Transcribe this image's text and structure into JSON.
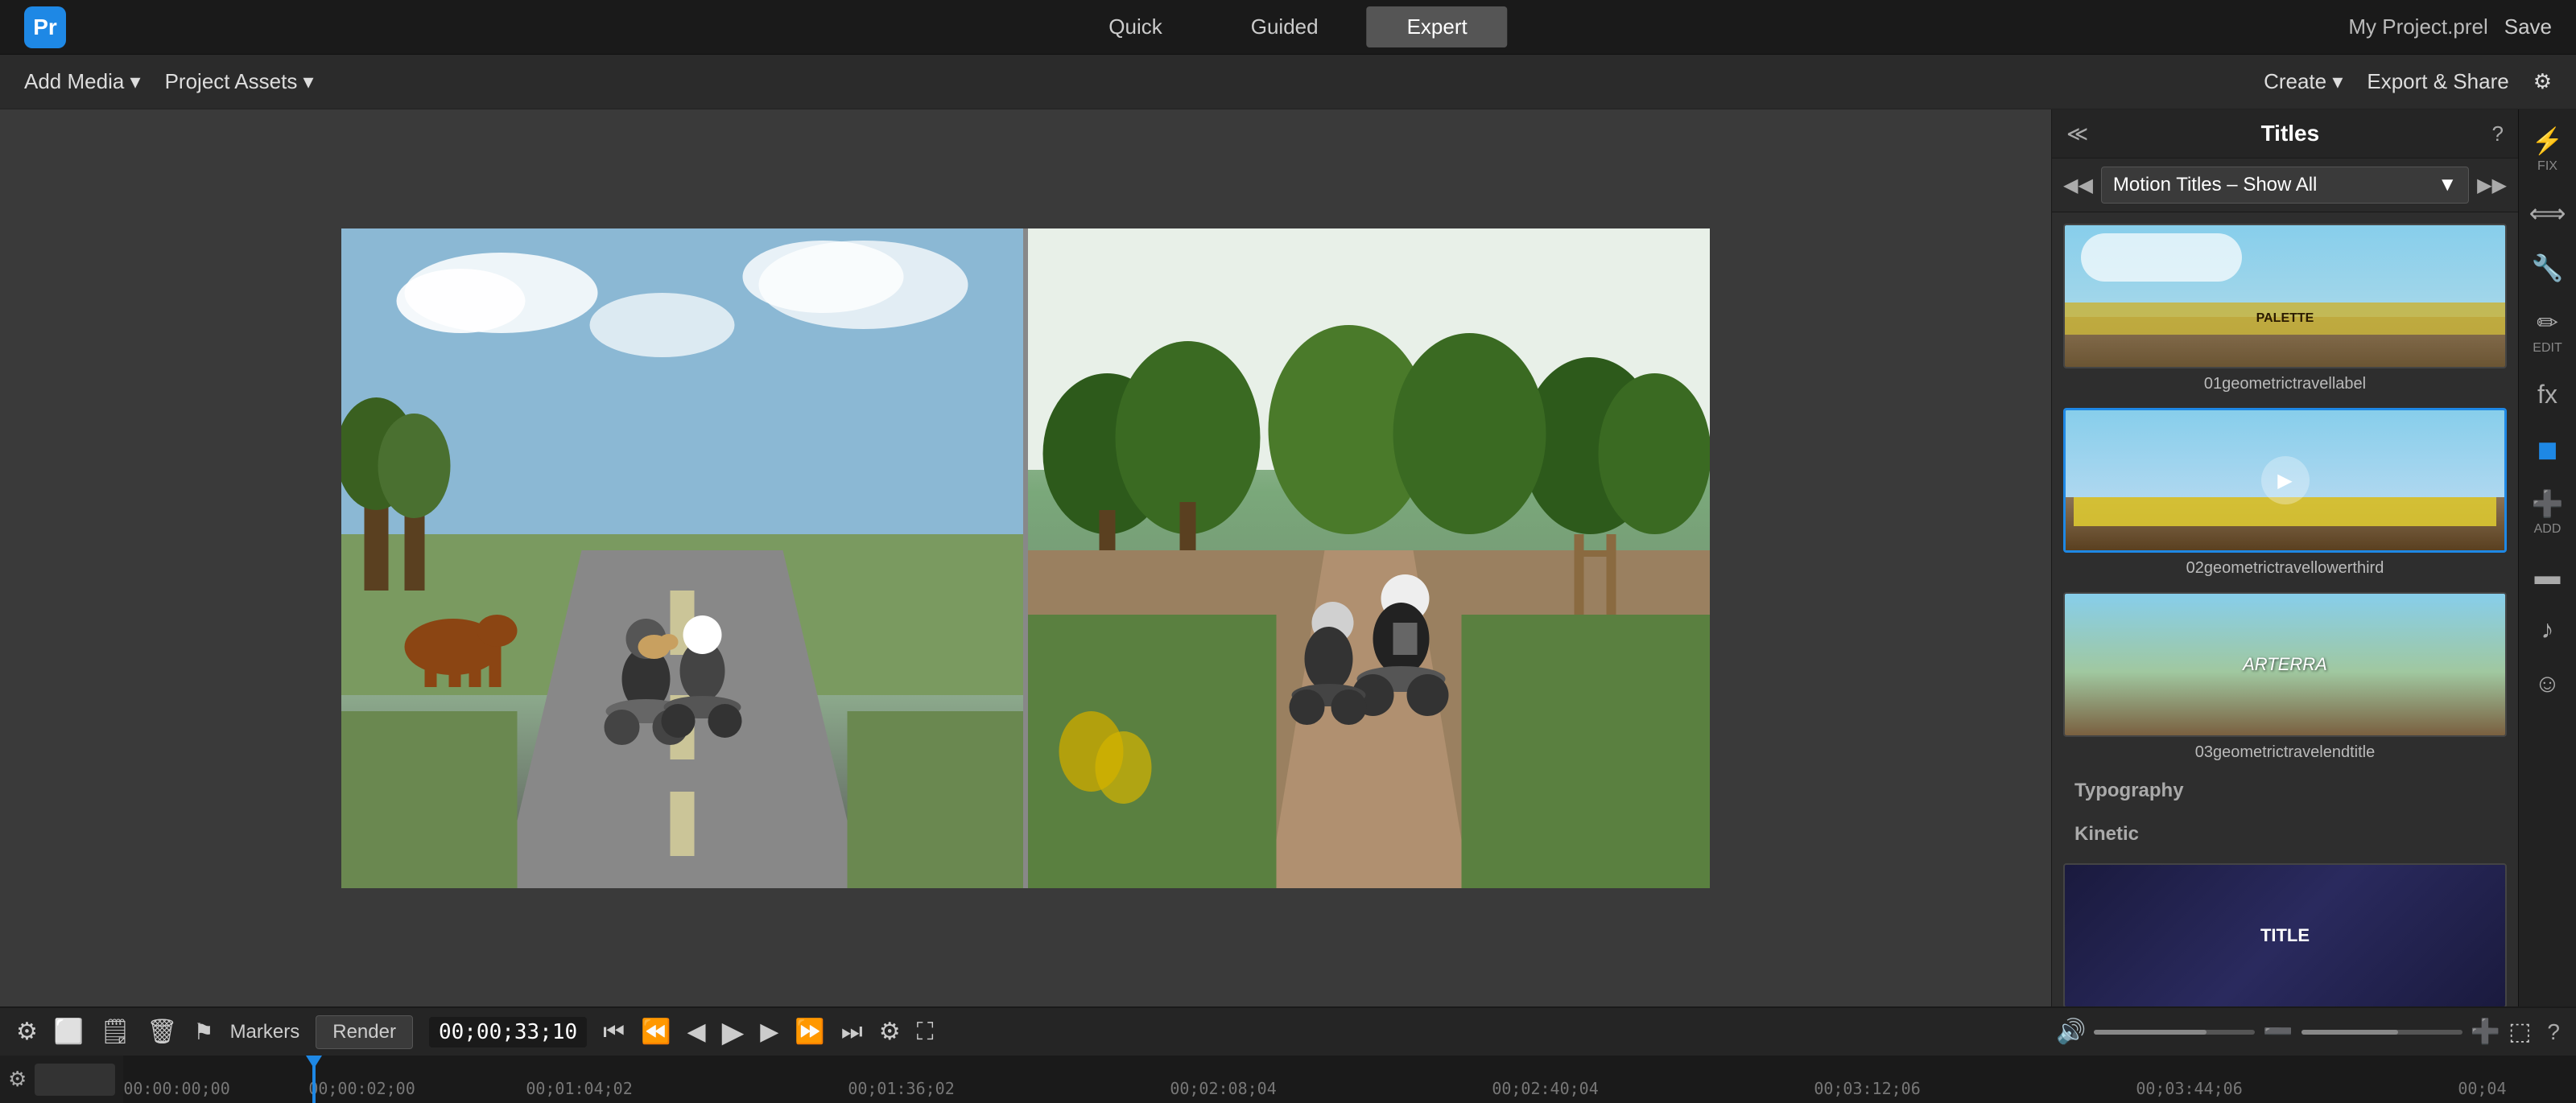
{
  "app": {
    "logo": "Pr",
    "project_name": "My Project.prel",
    "save_label": "Save"
  },
  "topbar": {
    "modes": [
      {
        "id": "quick",
        "label": "Quick",
        "active": false
      },
      {
        "id": "guided",
        "label": "Guided",
        "active": false
      },
      {
        "id": "expert",
        "label": "Expert",
        "active": true
      }
    ],
    "create_label": "Create ▾",
    "export_label": "Export & Share",
    "settings_label": "⚙"
  },
  "toolbar": {
    "add_media_label": "Add Media ▾",
    "project_assets_label": "Project Assets ▾"
  },
  "titles_panel": {
    "title": "Titles",
    "help_icon": "?",
    "collapse_icon": "≪",
    "dropdown_label": "Motion Titles – Show All",
    "items": [
      {
        "id": "01geometrictravellabel",
        "label": "01geometrictravellabel",
        "type": "label",
        "selected": false
      },
      {
        "id": "02geometrictravellowerthird",
        "label": "02geometrictravellowerthird",
        "type": "lowerthird",
        "selected": true
      },
      {
        "id": "03geometrictravelendtitle",
        "label": "03geometrictravelendtitle",
        "type": "endtitle",
        "selected": false
      }
    ],
    "section_typography": "Typography",
    "section_kinetic": "Kinetic"
  },
  "right_panel": {
    "fix_label": "FIX",
    "edit_label": "EDIT",
    "add_label": "ADD"
  },
  "playback": {
    "markers_label": "Markers",
    "render_label": "Render",
    "timecode": "00;00;33;10",
    "transport_icons": [
      "⏮",
      "⏪",
      "⏩",
      "▶",
      "⏩",
      "⏩",
      "⏭"
    ]
  },
  "timeline": {
    "current_time": "00:00:00;00",
    "marks": [
      "00;01:04;02",
      "00;01:36;02",
      "00;02:08;04",
      "00;02:40;04",
      "00;03:12;06",
      "00;03:44;06",
      "00;04"
    ]
  }
}
